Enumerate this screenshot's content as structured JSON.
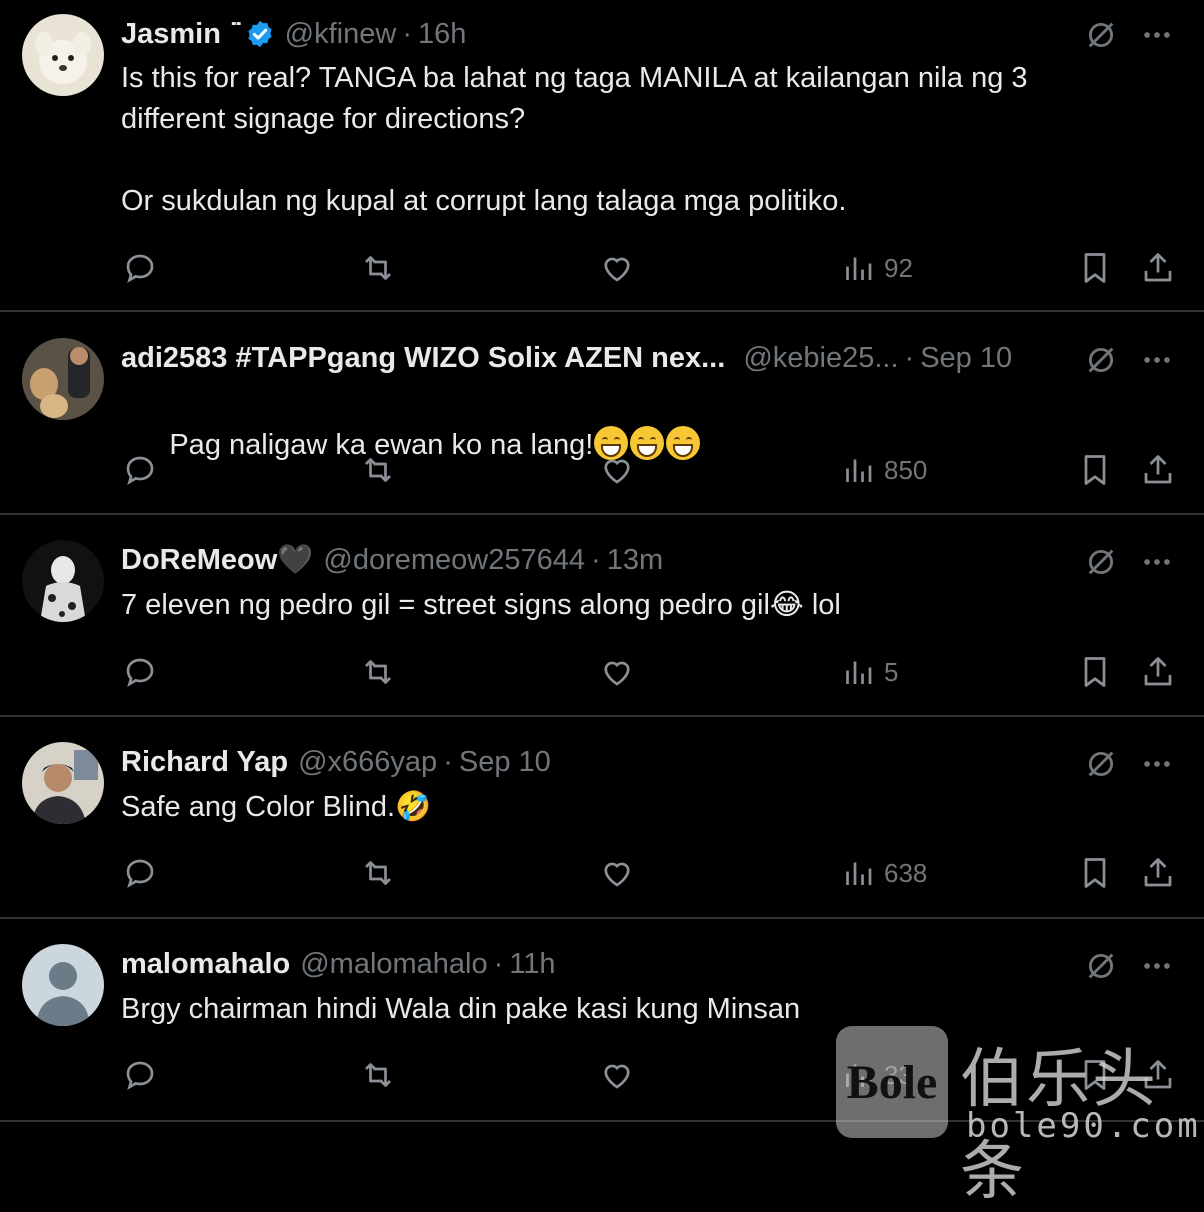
{
  "tweets": [
    {
      "name": "Jasmin ˙̇",
      "verified": true,
      "handle": "@kfinew",
      "time": "16h",
      "text": "Is this for real? TANGA ba lahat ng taga MANILA at kailangan nila ng 3\ndifferent signage for directions?\n\nOr sukdulan ng kupal at corrupt lang talaga mga politiko.",
      "views": "92"
    },
    {
      "name": "adi2583 #TAPPgang WIZO Solix AZEN nex...",
      "handle": "@kebie25...",
      "time": "Sep 10",
      "text": "Pag naligaw ka ewan ko na lang!",
      "views": "850"
    },
    {
      "name": "DoReMeow🖤",
      "handle": "@doremeow257644",
      "time": "13m",
      "text": "7 eleven ng pedro gil = street signs along pedro gil😂 lol",
      "views": "5"
    },
    {
      "name": "Richard Yap",
      "handle": "@x666yap",
      "time": "Sep 10",
      "text": "Safe ang Color Blind.🤣",
      "views": "638"
    },
    {
      "name": "malomahalo",
      "handle": "@malomahalo",
      "time": "11h",
      "text": "Brgy chairman hindi Wala din pake kasi kung Minsan",
      "views": "33"
    }
  ],
  "separator": "·",
  "watermark": {
    "logo": "Bole",
    "chinese": "伯乐头条",
    "url": "bole90.com"
  },
  "colors": {
    "background": "#000000",
    "text": "#e7e9ea",
    "muted": "#71767b",
    "verified": "#1d9bf0",
    "divider": "#2f3336"
  }
}
